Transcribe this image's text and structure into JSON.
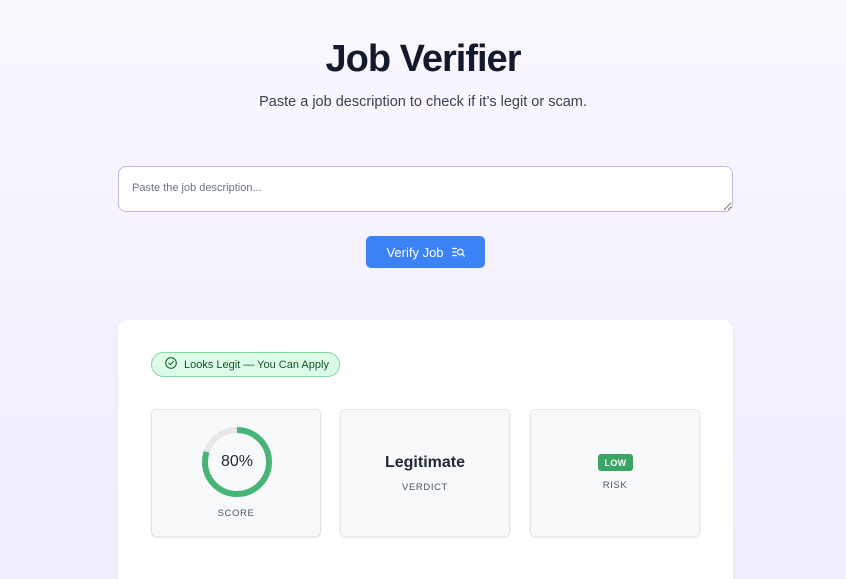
{
  "header": {
    "title": "Job Verifier",
    "subtitle": "Paste a job description to check if it’s legit or scam."
  },
  "input": {
    "placeholder": "Paste the job description...",
    "value": ""
  },
  "verify_button": {
    "label": "Verify Job",
    "icon": "list-search-icon"
  },
  "result": {
    "status": {
      "label": "Looks Legit — You Can Apply",
      "icon": "check-circle-icon"
    },
    "score": {
      "value": 80,
      "display": "80%",
      "label": "SCORE"
    },
    "verdict": {
      "value": "Legitimate",
      "label": "VERDICT"
    },
    "risk": {
      "value": "LOW",
      "label": "RISK"
    }
  },
  "colors": {
    "accent": "#3b82f6",
    "success": "#48b576",
    "badge_bg": "#dcfce7",
    "risk_low": "#3aa564"
  }
}
